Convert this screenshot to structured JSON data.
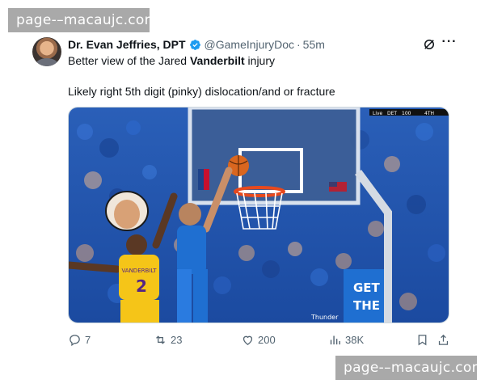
{
  "watermark": {
    "top": "page-–macaujc.com",
    "bottom": "page-–macaujc.com"
  },
  "author": {
    "display_name": "Dr. Evan Jeffries, DPT",
    "verified": true,
    "handle": "@GameInjuryDoc",
    "separator": "·",
    "time": "55m"
  },
  "icons": {
    "avatar": "profile-photo",
    "verified": "verified-badge-icon",
    "grok": "grok-icon",
    "more": "more-horizontal-icon",
    "reply": "reply-icon",
    "retweet": "retweet-icon",
    "like": "heart-icon",
    "views": "views-bar-chart-icon",
    "bookmark": "bookmark-icon",
    "share": "share-icon"
  },
  "text": {
    "line1_prefix": "Better view of the Jared ",
    "line1_bold": "Vanderbilt",
    "line1_suffix": " injury",
    "line2": "Likely right 5th digit (pinky) dislocation/and or fracture"
  },
  "media": {
    "scorebug": {
      "live": "Live",
      "team": "DET",
      "score": "100",
      "period": "4TH"
    },
    "jersey_name": "VANDERBILT",
    "jersey_number": "2",
    "sign_get": "GET",
    "sign_the": "THE",
    "sign_thunder": "Thunder"
  },
  "stats": {
    "replies": "7",
    "reposts": "23",
    "likes": "200",
    "views": "38K"
  },
  "colors": {
    "link_blue": "#1d9bf0",
    "secondary_text": "#536471",
    "crowd_blue": "#1f63c8",
    "lakers_gold": "#f5c518",
    "thunder_blue": "#1f6fd1"
  }
}
